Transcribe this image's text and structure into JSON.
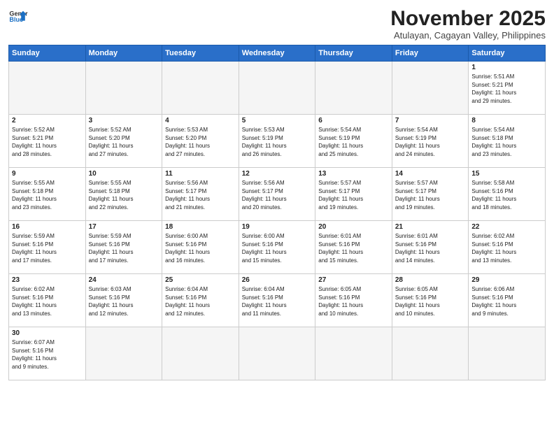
{
  "header": {
    "logo_general": "General",
    "logo_blue": "Blue",
    "month_title": "November 2025",
    "subtitle": "Atulayan, Cagayan Valley, Philippines"
  },
  "days_of_week": [
    "Sunday",
    "Monday",
    "Tuesday",
    "Wednesday",
    "Thursday",
    "Friday",
    "Saturday"
  ],
  "weeks": [
    [
      {
        "day": "",
        "info": ""
      },
      {
        "day": "",
        "info": ""
      },
      {
        "day": "",
        "info": ""
      },
      {
        "day": "",
        "info": ""
      },
      {
        "day": "",
        "info": ""
      },
      {
        "day": "",
        "info": ""
      },
      {
        "day": "1",
        "info": "Sunrise: 5:51 AM\nSunset: 5:21 PM\nDaylight: 11 hours\nand 29 minutes."
      }
    ],
    [
      {
        "day": "2",
        "info": "Sunrise: 5:52 AM\nSunset: 5:21 PM\nDaylight: 11 hours\nand 28 minutes."
      },
      {
        "day": "3",
        "info": "Sunrise: 5:52 AM\nSunset: 5:20 PM\nDaylight: 11 hours\nand 27 minutes."
      },
      {
        "day": "4",
        "info": "Sunrise: 5:53 AM\nSunset: 5:20 PM\nDaylight: 11 hours\nand 27 minutes."
      },
      {
        "day": "5",
        "info": "Sunrise: 5:53 AM\nSunset: 5:19 PM\nDaylight: 11 hours\nand 26 minutes."
      },
      {
        "day": "6",
        "info": "Sunrise: 5:54 AM\nSunset: 5:19 PM\nDaylight: 11 hours\nand 25 minutes."
      },
      {
        "day": "7",
        "info": "Sunrise: 5:54 AM\nSunset: 5:19 PM\nDaylight: 11 hours\nand 24 minutes."
      },
      {
        "day": "8",
        "info": "Sunrise: 5:54 AM\nSunset: 5:18 PM\nDaylight: 11 hours\nand 23 minutes."
      }
    ],
    [
      {
        "day": "9",
        "info": "Sunrise: 5:55 AM\nSunset: 5:18 PM\nDaylight: 11 hours\nand 23 minutes."
      },
      {
        "day": "10",
        "info": "Sunrise: 5:55 AM\nSunset: 5:18 PM\nDaylight: 11 hours\nand 22 minutes."
      },
      {
        "day": "11",
        "info": "Sunrise: 5:56 AM\nSunset: 5:17 PM\nDaylight: 11 hours\nand 21 minutes."
      },
      {
        "day": "12",
        "info": "Sunrise: 5:56 AM\nSunset: 5:17 PM\nDaylight: 11 hours\nand 20 minutes."
      },
      {
        "day": "13",
        "info": "Sunrise: 5:57 AM\nSunset: 5:17 PM\nDaylight: 11 hours\nand 19 minutes."
      },
      {
        "day": "14",
        "info": "Sunrise: 5:57 AM\nSunset: 5:17 PM\nDaylight: 11 hours\nand 19 minutes."
      },
      {
        "day": "15",
        "info": "Sunrise: 5:58 AM\nSunset: 5:16 PM\nDaylight: 11 hours\nand 18 minutes."
      }
    ],
    [
      {
        "day": "16",
        "info": "Sunrise: 5:59 AM\nSunset: 5:16 PM\nDaylight: 11 hours\nand 17 minutes."
      },
      {
        "day": "17",
        "info": "Sunrise: 5:59 AM\nSunset: 5:16 PM\nDaylight: 11 hours\nand 17 minutes."
      },
      {
        "day": "18",
        "info": "Sunrise: 6:00 AM\nSunset: 5:16 PM\nDaylight: 11 hours\nand 16 minutes."
      },
      {
        "day": "19",
        "info": "Sunrise: 6:00 AM\nSunset: 5:16 PM\nDaylight: 11 hours\nand 15 minutes."
      },
      {
        "day": "20",
        "info": "Sunrise: 6:01 AM\nSunset: 5:16 PM\nDaylight: 11 hours\nand 15 minutes."
      },
      {
        "day": "21",
        "info": "Sunrise: 6:01 AM\nSunset: 5:16 PM\nDaylight: 11 hours\nand 14 minutes."
      },
      {
        "day": "22",
        "info": "Sunrise: 6:02 AM\nSunset: 5:16 PM\nDaylight: 11 hours\nand 13 minutes."
      }
    ],
    [
      {
        "day": "23",
        "info": "Sunrise: 6:02 AM\nSunset: 5:16 PM\nDaylight: 11 hours\nand 13 minutes."
      },
      {
        "day": "24",
        "info": "Sunrise: 6:03 AM\nSunset: 5:16 PM\nDaylight: 11 hours\nand 12 minutes."
      },
      {
        "day": "25",
        "info": "Sunrise: 6:04 AM\nSunset: 5:16 PM\nDaylight: 11 hours\nand 12 minutes."
      },
      {
        "day": "26",
        "info": "Sunrise: 6:04 AM\nSunset: 5:16 PM\nDaylight: 11 hours\nand 11 minutes."
      },
      {
        "day": "27",
        "info": "Sunrise: 6:05 AM\nSunset: 5:16 PM\nDaylight: 11 hours\nand 10 minutes."
      },
      {
        "day": "28",
        "info": "Sunrise: 6:05 AM\nSunset: 5:16 PM\nDaylight: 11 hours\nand 10 minutes."
      },
      {
        "day": "29",
        "info": "Sunrise: 6:06 AM\nSunset: 5:16 PM\nDaylight: 11 hours\nand 9 minutes."
      }
    ],
    [
      {
        "day": "30",
        "info": "Sunrise: 6:07 AM\nSunset: 5:16 PM\nDaylight: 11 hours\nand 9 minutes."
      },
      {
        "day": "",
        "info": ""
      },
      {
        "day": "",
        "info": ""
      },
      {
        "day": "",
        "info": ""
      },
      {
        "day": "",
        "info": ""
      },
      {
        "day": "",
        "info": ""
      },
      {
        "day": "",
        "info": ""
      }
    ]
  ]
}
